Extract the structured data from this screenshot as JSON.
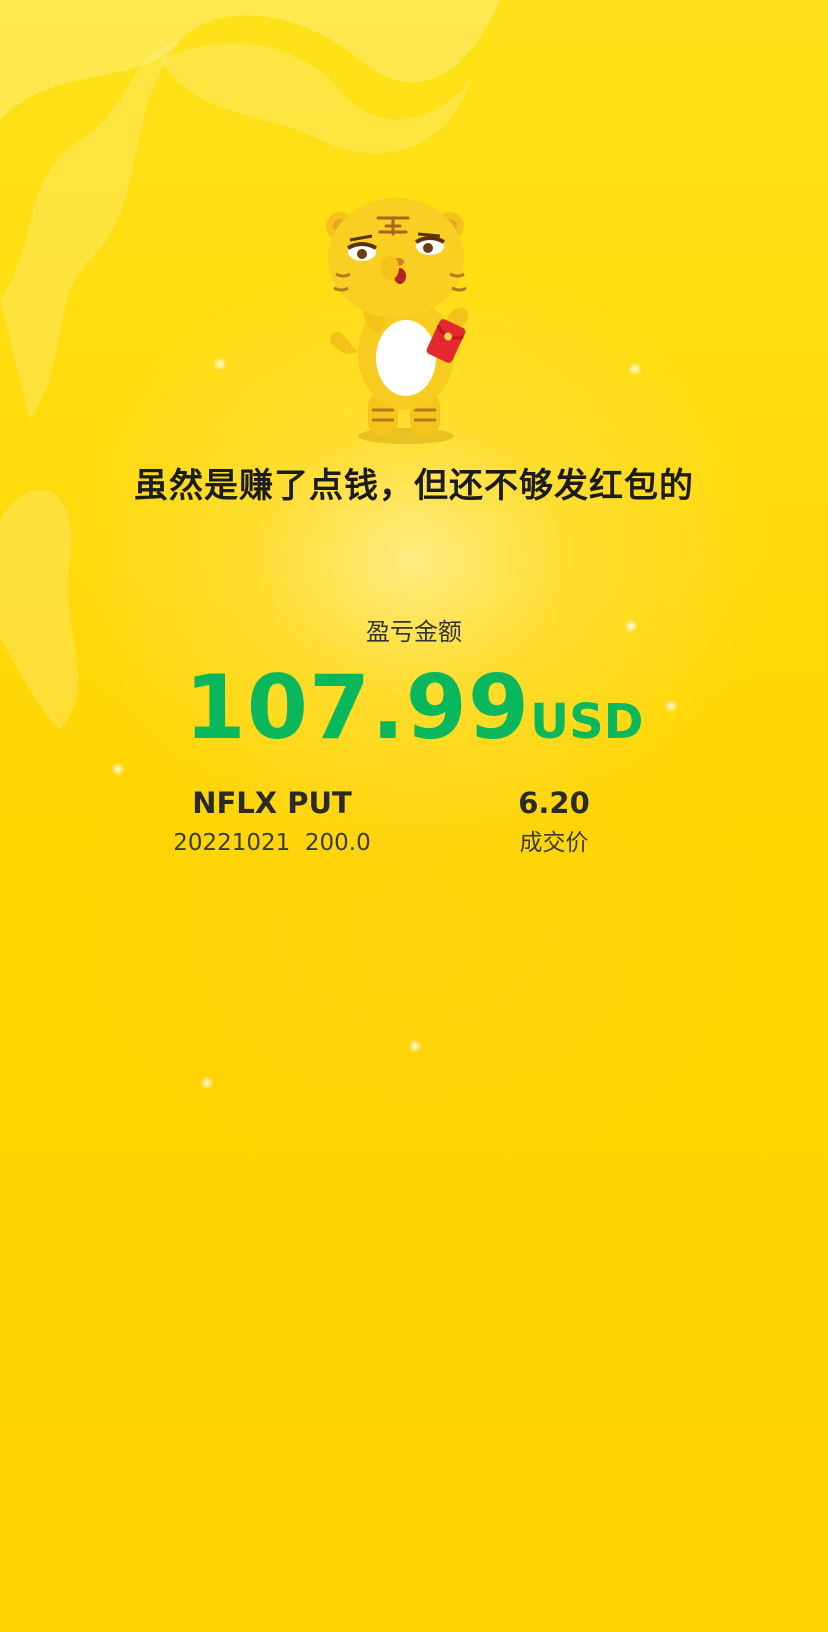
{
  "mascot": {
    "icon": "tiger-mascot-holding-red-envelope-icon"
  },
  "headline": "虽然是赚了点钱，但还不够发红包的",
  "pnl": {
    "label": "盈亏金额",
    "value": "107.99",
    "currency": "USD",
    "color": "#0ab75c"
  },
  "contract": {
    "symbol": "NFLX PUT",
    "expiry_strike": "20221021  200.0"
  },
  "trade": {
    "price": "6.20",
    "price_label": "成交价"
  },
  "colors": {
    "background": "#ffd800",
    "text": "#1c1c1c"
  }
}
